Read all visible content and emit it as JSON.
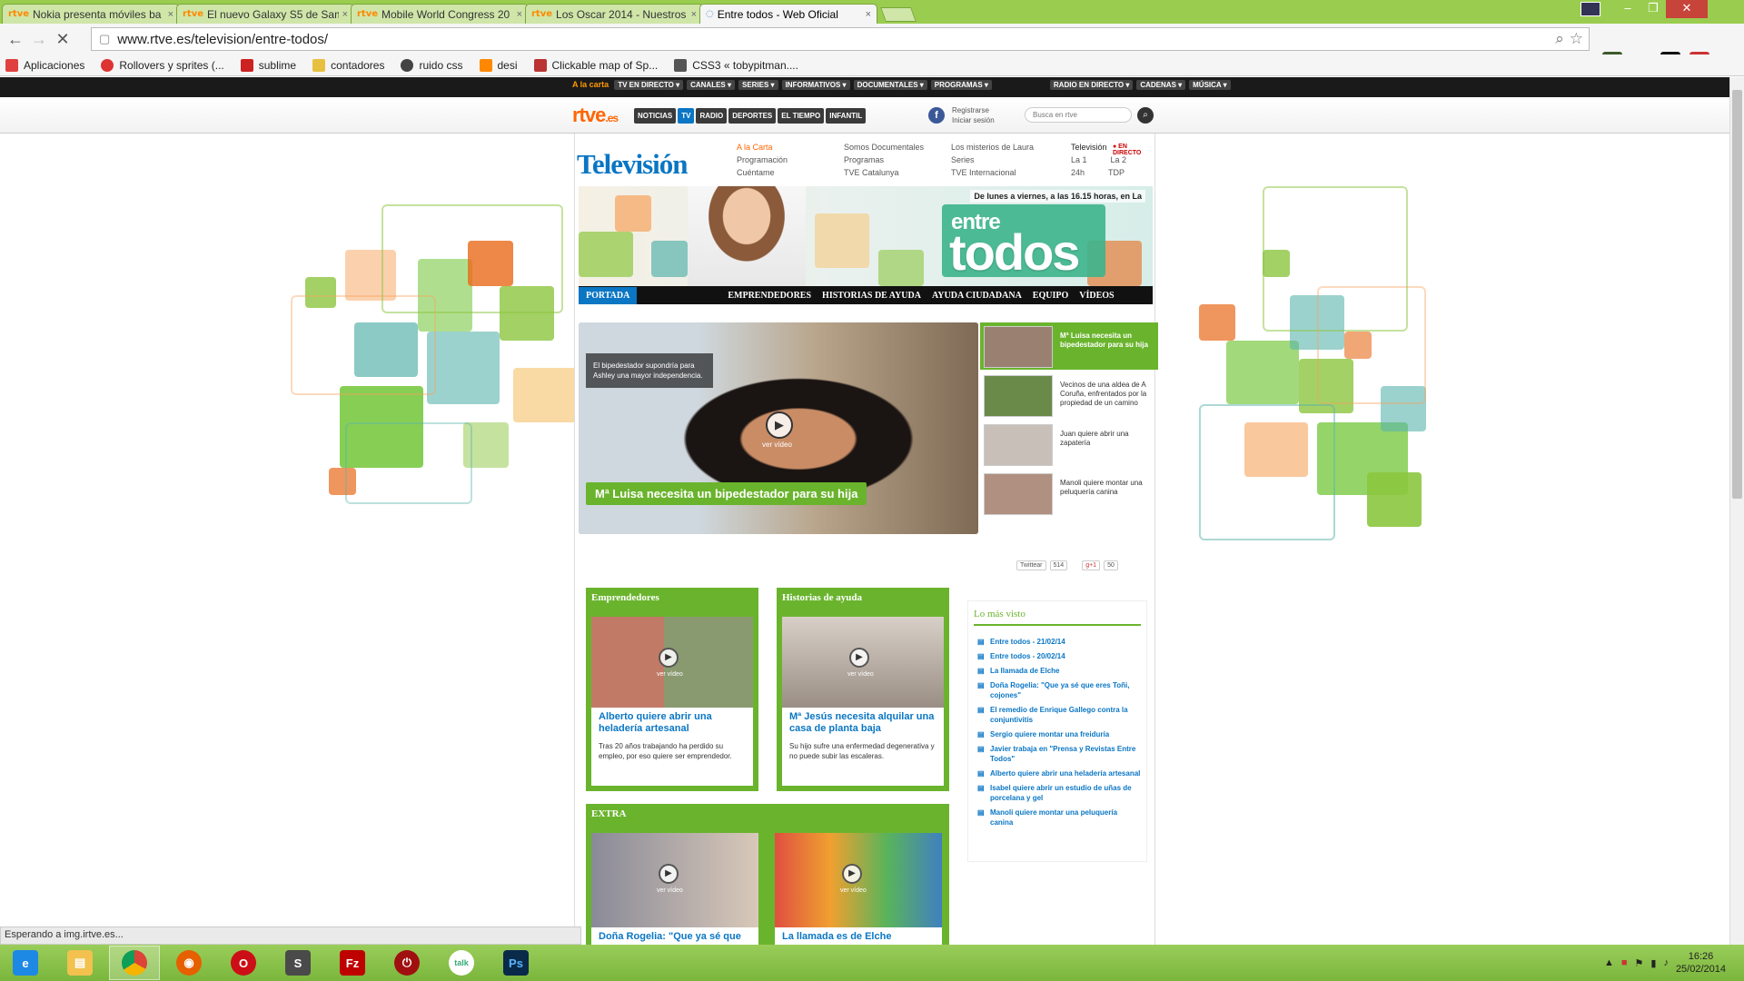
{
  "tabs": [
    {
      "label": "Nokia presenta móviles ba",
      "fav": "rtve"
    },
    {
      "label": "El nuevo Galaxy S5 de Sam",
      "fav": "rtve"
    },
    {
      "label": "Mobile World Congress 20",
      "fav": "rtve"
    },
    {
      "label": "Los Oscar 2014 - Nuestros",
      "fav": "rtve"
    },
    {
      "label": "Entre todos - Web Oficial",
      "fav": "loading"
    }
  ],
  "toolbar": {
    "url": "www.rtve.es/television/entre-todos/"
  },
  "bookmarks": [
    {
      "label": "Aplicaciones",
      "color": "#e04040"
    },
    {
      "label": "Rollovers y sprites (...",
      "color": "#d33"
    },
    {
      "label": "sublime",
      "color": "#c22"
    },
    {
      "label": "contadores",
      "color": "#e8c040"
    },
    {
      "label": "ruido css",
      "color": "#444"
    },
    {
      "label": "desi",
      "color": "#f80"
    },
    {
      "label": "Clickable map of Sp...",
      "color": "#b33"
    },
    {
      "label": "CSS3 « tobypitman....",
      "color": "#555"
    }
  ],
  "rtve": {
    "alacarta": "A la carta",
    "topmenu": [
      "TV EN DIRECTO ▾",
      "CANALES ▾",
      "SERIES ▾",
      "INFORMATIVOS ▾",
      "DOCUMENTALES ▾",
      "PROGRAMAS ▾",
      "RADIO EN DIRECTO ▾",
      "CADENAS ▾",
      "MÚSICA ▾"
    ],
    "logo": "rtve",
    "logo_suffix": ".es",
    "nav": [
      "NOTICIAS",
      "TV",
      "RADIO",
      "DEPORTES",
      "EL TIEMPO",
      "INFANTIL"
    ],
    "facebook": "f",
    "register": "Registrarse",
    "login": "Iniciar sesión",
    "search_placeholder": "Busca en rtve"
  },
  "tv": {
    "title": "Televisión",
    "col1": [
      "A la Carta",
      "Programación",
      "Cuéntame"
    ],
    "col2": [
      "Somos Documentales",
      "Programas",
      "TVE Catalunya"
    ],
    "col3": [
      "Los misterios de Laura",
      "Series",
      "TVE Internacional"
    ],
    "col4_head": "Televisión",
    "endirecto": "● EN DIRECTO",
    "channels": [
      "La 1",
      "La 2",
      "24h",
      "TDP"
    ]
  },
  "banner": {
    "tagline": "De lunes a viernes, a las 16.15 horas, en La",
    "entre": "entre",
    "todos": "todos"
  },
  "subnav": [
    "PORTADA",
    "EMPRENDEDORES",
    "HISTORIAS DE AYUDA",
    "AYUDA CIUDADANA",
    "EQUIPO",
    "VÍDEOS"
  ],
  "featured": {
    "caption": "El bipedestador supondría para Ashley una mayor independencia.",
    "ver": "ver vídeo",
    "title": "Mª Luisa necesita un bipedestador para su hija"
  },
  "side_items": [
    "Mª Luisa necesita un bipedestador para su hija",
    "Vecinos de una aldea de A Coruña, enfrentados por la propiedad de un camino",
    "Juan quiere abrir una zapatería",
    "Manoli quiere montar una peluquería canina"
  ],
  "social": {
    "twitter": "Twittear",
    "tw_count": "514",
    "gplus": "g+1",
    "gp_count": "50"
  },
  "emprendedores": {
    "header": "Emprendedores",
    "ver": "ver vídeo",
    "title": "Alberto quiere abrir una heladería artesanal",
    "desc": "Tras 20 años trabajando ha perdido su empleo, por eso quiere ser emprendedor."
  },
  "historias": {
    "header": "Historias de ayuda",
    "ver": "ver vídeo",
    "title": "Mª Jesús necesita alquilar una casa de planta baja",
    "desc": "Su hijo sufre una enfermedad degenerativa y no puede subir las escaleras."
  },
  "extra": {
    "header": "EXTRA",
    "ver": "ver vídeo",
    "title1": "Doña Rogelia: \"Que ya sé que",
    "title2": "La llamada es de Elche"
  },
  "masvisto": {
    "header": "Lo más visto",
    "items": [
      "Entre todos - 21/02/14",
      "Entre todos - 20/02/14",
      "La llamada de Elche",
      "Doña Rogelia: \"Que ya sé que eres Toñi, cojones\"",
      "El remedio de Enrique Gallego contra la conjuntivitis",
      "Sergio quiere montar una freiduría",
      "Javier trabaja en \"Prensa y Revistas Entre Todos\"",
      "Alberto quiere abrir una heladería artesanal",
      "Isabel quiere abrir un estudio de uñas de porcelana y gel",
      "Manoli quiere montar una peluquería canina"
    ]
  },
  "status": "Esperando a img.irtve.es...",
  "clock": {
    "time": "16:26",
    "date": "25/02/2014"
  }
}
